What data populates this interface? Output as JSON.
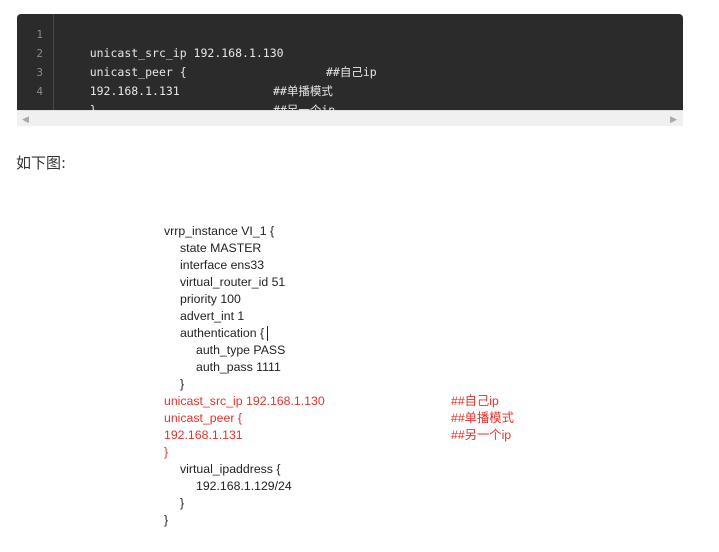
{
  "code_block": {
    "lines": [
      {
        "num": "1",
        "code": "unicast_src_ip 192.168.1.130",
        "comment": "##自己ip"
      },
      {
        "num": "2",
        "code": "unicast_peer {",
        "comment": "##单播模式"
      },
      {
        "num": "3",
        "code": "192.168.1.131",
        "comment": "##另一个ip"
      },
      {
        "num": "4",
        "code": "}",
        "comment": ""
      }
    ],
    "scroll_left_icon": "arrow-left-icon",
    "scroll_right_icon": "arrow-right-icon"
  },
  "caption": "如下图:",
  "config_image": {
    "lines": [
      {
        "text": "vrrp_instance VI_1 {",
        "comment": "",
        "indent": 0,
        "highlight": false
      },
      {
        "text": "state MASTER",
        "comment": "",
        "indent": 1,
        "highlight": false
      },
      {
        "text": "interface ens33",
        "comment": "",
        "indent": 1,
        "highlight": false
      },
      {
        "text": "virtual_router_id 51",
        "comment": "",
        "indent": 1,
        "highlight": false
      },
      {
        "text": "priority 100",
        "comment": "",
        "indent": 1,
        "highlight": false
      },
      {
        "text": "advert_int 1",
        "comment": "",
        "indent": 1,
        "highlight": false
      },
      {
        "text": "authentication {",
        "comment": "",
        "indent": 1,
        "highlight": false
      },
      {
        "text": "auth_type PASS",
        "comment": "",
        "indent": 2,
        "highlight": false
      },
      {
        "text": "auth_pass 1111",
        "comment": "",
        "indent": 2,
        "highlight": false
      },
      {
        "text": "}",
        "comment": "",
        "indent": 1,
        "highlight": false
      },
      {
        "text": "unicast_src_ip 192.168.1.130",
        "comment": "##自己ip",
        "indent": 0,
        "highlight": true
      },
      {
        "text": "unicast_peer {",
        "comment": "##单播模式",
        "indent": 0,
        "highlight": true
      },
      {
        "text": "192.168.1.131",
        "comment": "##另一个ip",
        "indent": 0,
        "highlight": true
      },
      {
        "text": "}",
        "comment": "",
        "indent": 0,
        "highlight": true
      },
      {
        "text": "virtual_ipaddress {",
        "comment": "",
        "indent": 1,
        "highlight": false
      },
      {
        "text": "192.168.1.129/24",
        "comment": "",
        "indent": 2,
        "highlight": false
      },
      {
        "text": "}",
        "comment": "",
        "indent": 1,
        "highlight": false
      },
      {
        "text": "}",
        "comment": "",
        "indent": 0,
        "highlight": false
      }
    ],
    "colors": {
      "normal": "#222222",
      "highlight": "#e8312a"
    }
  }
}
